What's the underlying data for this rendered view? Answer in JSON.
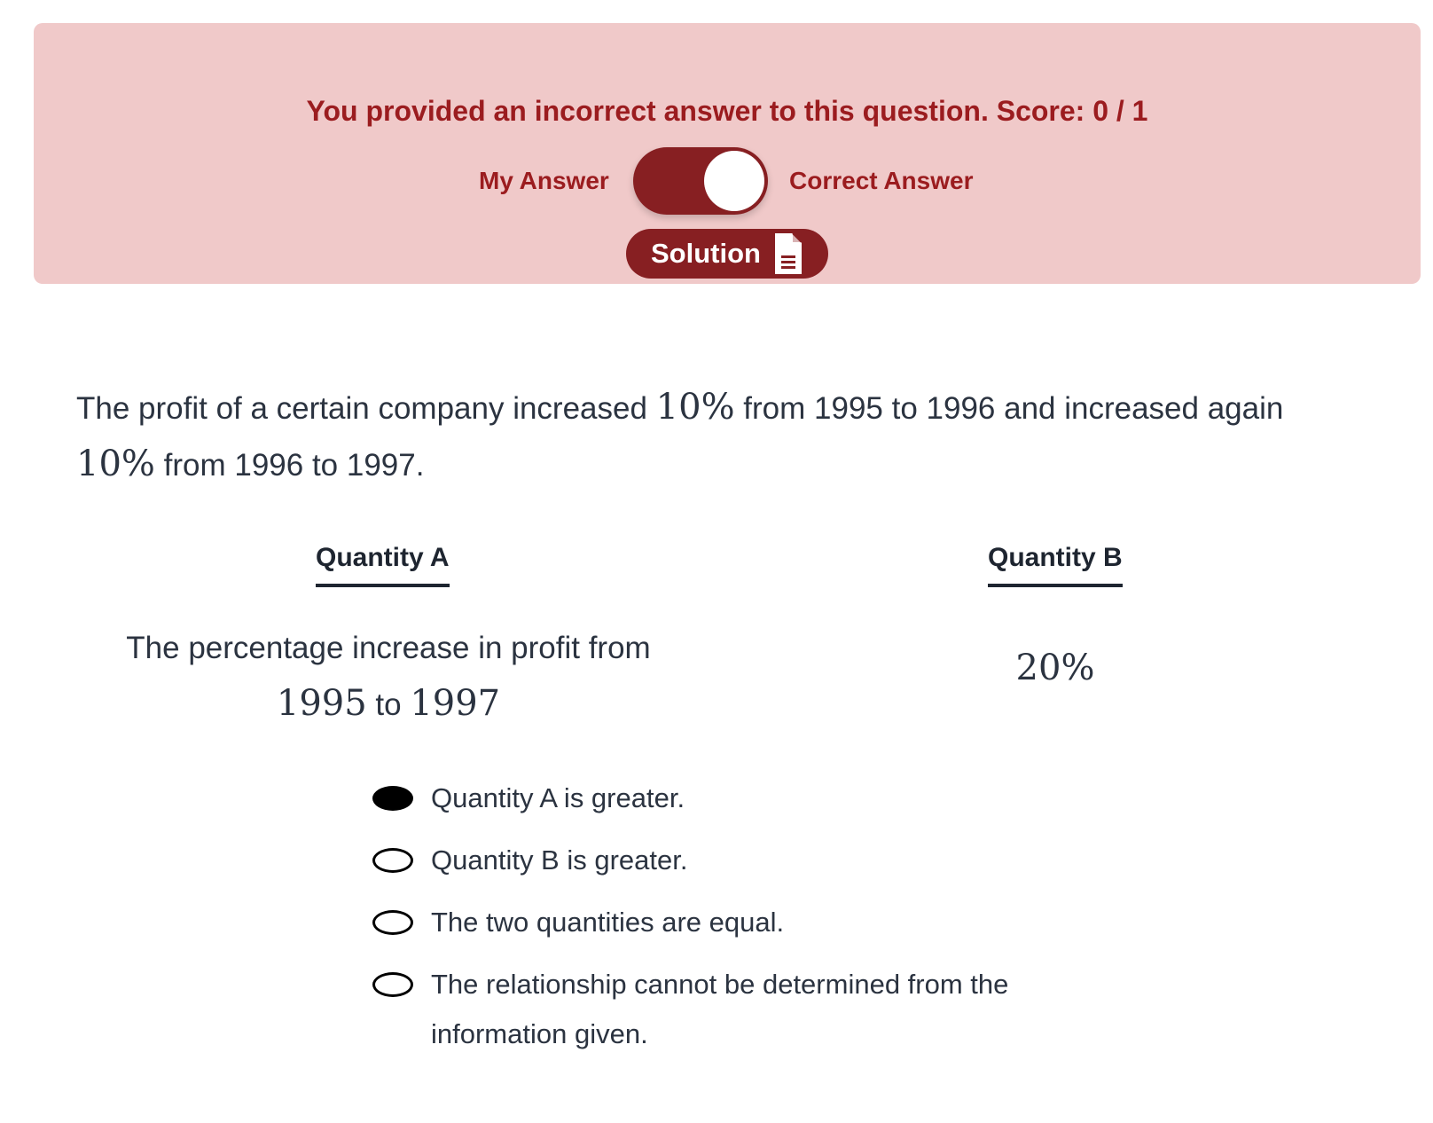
{
  "banner": {
    "message": "You provided an incorrect answer to this question. Score: 0 / 1",
    "toggle": {
      "left_label": "My Answer",
      "right_label": "Correct Answer",
      "state": "correct-answer"
    },
    "solution_button": {
      "label": "Solution",
      "icon": "document-icon"
    }
  },
  "question": {
    "text_1": "The profit of a certain company increased ",
    "pct_1": "10%",
    "text_2": " from 1995 to 1996 and increased again ",
    "pct_2": "10%",
    "text_3": " from 1996 to 1997."
  },
  "quantities": {
    "a": {
      "label": "Quantity A",
      "line_1": "The percentage increase in profit from",
      "year_from": "1995",
      "connector": " to ",
      "year_to": "1997"
    },
    "b": {
      "label": "Quantity B",
      "value": "20%"
    }
  },
  "options": [
    {
      "label": "Quantity A is greater.",
      "selected": true
    },
    {
      "label": "Quantity B is greater.",
      "selected": false
    },
    {
      "label": "The two quantities are equal.",
      "selected": false
    },
    {
      "label": "The relationship cannot be determined from the information given.",
      "selected": false
    }
  ],
  "colors": {
    "banner_bg": "#f0c9c9",
    "accent": "#871f22",
    "error_text": "#9b1c1f",
    "body_text": "#2b3340"
  }
}
